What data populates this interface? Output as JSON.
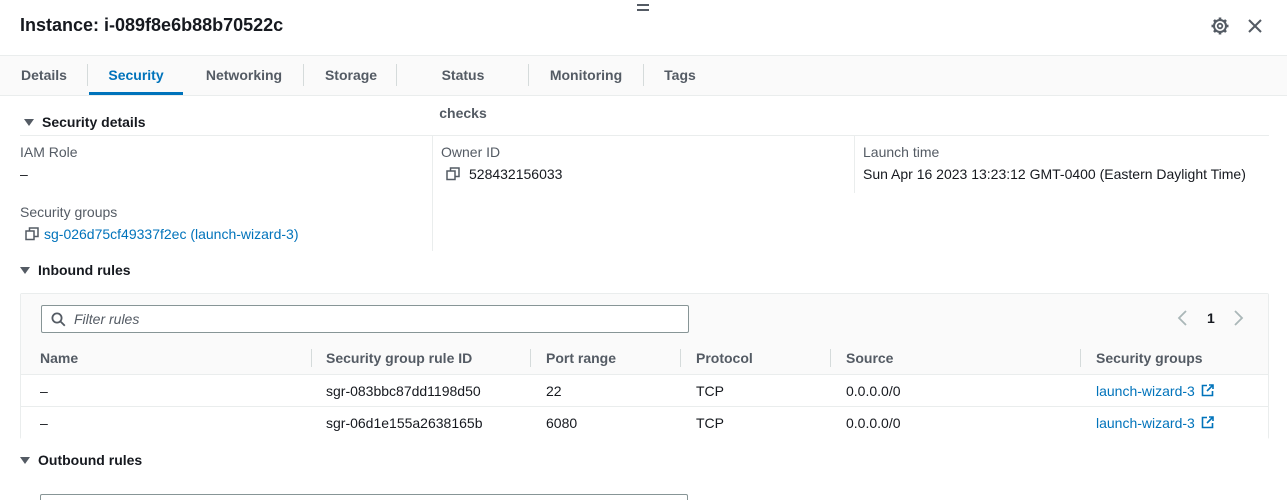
{
  "header": {
    "title": "Instance: i-089f8e6b88b70522c",
    "icons": [
      "drag-handle-icon",
      "gear-icon",
      "close-icon"
    ]
  },
  "tabs": [
    {
      "label": "Details",
      "active": false
    },
    {
      "label": "Security",
      "active": true
    },
    {
      "label": "Networking",
      "active": false
    },
    {
      "label": "Storage",
      "active": false
    },
    {
      "label": "Status checks",
      "active": false
    },
    {
      "label": "Monitoring",
      "active": false
    },
    {
      "label": "Tags",
      "active": false
    }
  ],
  "security_details": {
    "heading": "Security details",
    "iam_role_label": "IAM Role",
    "iam_role_value": "–",
    "owner_id_label": "Owner ID",
    "owner_id_value": "528432156033",
    "launch_time_label": "Launch time",
    "launch_time_value": "Sun Apr 16 2023 13:23:12 GMT-0400 (Eastern Daylight Time)",
    "security_groups_label": "Security groups",
    "security_groups_value": "sg-026d75cf49337f2ec (launch-wizard-3)"
  },
  "inbound_rules": {
    "heading": "Inbound rules",
    "filter_placeholder": "Filter rules",
    "page": "1",
    "columns": [
      "Name",
      "Security group rule ID",
      "Port range",
      "Protocol",
      "Source",
      "Security groups"
    ],
    "rows": [
      {
        "name": "–",
        "rule_id": "sgr-083bbc87dd1198d50",
        "port_range": "22",
        "protocol": "TCP",
        "source": "0.0.0.0/0",
        "security_group": "launch-wizard-3"
      },
      {
        "name": "–",
        "rule_id": "sgr-06d1e155a2638165b",
        "port_range": "6080",
        "protocol": "TCP",
        "source": "0.0.0.0/0",
        "security_group": "launch-wizard-3"
      }
    ]
  },
  "outbound_rules": {
    "heading": "Outbound rules"
  },
  "colors": {
    "accent": "#0073bb",
    "text": "#16191f",
    "muted": "#545b64",
    "border": "#eaeded"
  }
}
